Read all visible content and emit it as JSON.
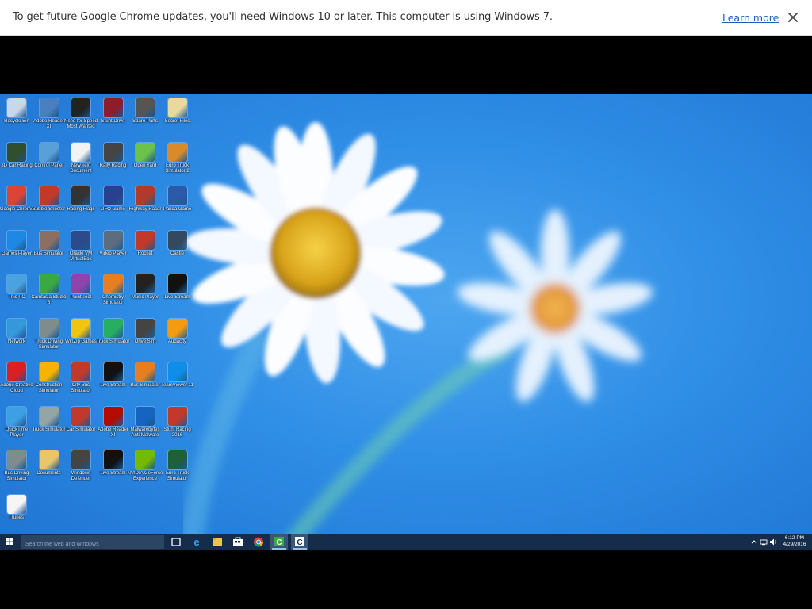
{
  "infobar": {
    "message": "To get future Google Chrome updates, you'll need Windows 10 or later. This computer is using Windows 7.",
    "learn_more": "Learn more"
  },
  "desktop": {
    "icons": [
      {
        "label": "Recycle Bin",
        "icon": "recycle-bin-icon",
        "color": "#c9d8e8"
      },
      {
        "label": "Adobe Reader XI",
        "icon": "app-icon",
        "color": "#4a7fc1"
      },
      {
        "label": "Need for Speed Most Wanted",
        "icon": "game-icon",
        "color": "#222222"
      },
      {
        "label": "Stunt Drive",
        "icon": "game-icon",
        "color": "#8b1d2c"
      },
      {
        "label": "Spare Parts",
        "icon": "game-icon",
        "color": "#555555"
      },
      {
        "label": "Secret Files",
        "icon": "folder-icon",
        "color": "#e8d9a0"
      },
      {
        "label": "3D Car Racing",
        "icon": "game-icon",
        "color": "#2f4f2f"
      },
      {
        "label": "Control Panel",
        "icon": "control-panel-icon",
        "color": "#5aa0d8"
      },
      {
        "label": "New Text Document",
        "icon": "document-icon",
        "color": "#f2f2f2"
      },
      {
        "label": "Rally Racing",
        "icon": "game-icon",
        "color": "#444444"
      },
      {
        "label": "Open Yard",
        "icon": "app-icon",
        "color": "#6cc24a"
      },
      {
        "label": "Euro Truck Simulator 2",
        "icon": "game-icon",
        "color": "#d98b2a"
      },
      {
        "label": "Google Chrome",
        "icon": "chrome-icon",
        "color": "#db4437"
      },
      {
        "label": "Bubble Shooter",
        "icon": "game-icon",
        "color": "#c0392b"
      },
      {
        "label": "Racing Flags",
        "icon": "game-icon",
        "color": "#333333"
      },
      {
        "label": "UFO Game",
        "icon": "game-icon",
        "color": "#2a3f8f"
      },
      {
        "label": "Highway Racer",
        "icon": "game-icon",
        "color": "#b03a2e"
      },
      {
        "label": "Panda Game",
        "icon": "game-icon",
        "color": "#2b5aa8"
      },
      {
        "label": "Games Player",
        "icon": "app-icon",
        "color": "#1e88e5"
      },
      {
        "label": "Bus Simulator",
        "icon": "game-icon",
        "color": "#8d6e63"
      },
      {
        "label": "Oracle VM VirtualBox",
        "icon": "virtualbox-icon",
        "color": "#2b4b8c"
      },
      {
        "label": "Video Player",
        "icon": "app-icon",
        "color": "#5d6d7e"
      },
      {
        "label": "Rocket",
        "icon": "game-icon",
        "color": "#c0392b"
      },
      {
        "label": "Castle",
        "icon": "game-icon",
        "color": "#34495e"
      },
      {
        "label": "This PC",
        "icon": "computer-icon",
        "color": "#4aa3df"
      },
      {
        "label": "Camtasia Studio 8",
        "icon": "camtasia-icon",
        "color": "#3aa845"
      },
      {
        "label": "Paint Tool",
        "icon": "app-icon",
        "color": "#8e44ad"
      },
      {
        "label": "Chemistry Simulator",
        "icon": "app-icon",
        "color": "#e67e22"
      },
      {
        "label": "Music Player",
        "icon": "music-icon",
        "color": "#222222"
      },
      {
        "label": "Live Stream",
        "icon": "app-icon",
        "color": "#111111"
      },
      {
        "label": "Network",
        "icon": "network-icon",
        "color": "#3498db"
      },
      {
        "label": "Truck Driving Simulator",
        "icon": "game-icon",
        "color": "#7f8c8d"
      },
      {
        "label": "WinZip Games",
        "icon": "game-icon",
        "color": "#f1c40f"
      },
      {
        "label": "Truck Simulator",
        "icon": "game-icon",
        "color": "#27ae60"
      },
      {
        "label": "Drive Sim",
        "icon": "game-icon",
        "color": "#444444"
      },
      {
        "label": "Audacity",
        "icon": "audacity-icon",
        "color": "#f39c12"
      },
      {
        "label": "Adobe Creative Cloud",
        "icon": "adobe-cc-icon",
        "color": "#da1f26"
      },
      {
        "label": "Construction Simulator",
        "icon": "game-icon",
        "color": "#f4b400"
      },
      {
        "label": "City Bus Simulator",
        "icon": "game-icon",
        "color": "#c0392b"
      },
      {
        "label": "Live Stream",
        "icon": "app-icon",
        "color": "#111111"
      },
      {
        "label": "Bus Simulator",
        "icon": "game-icon",
        "color": "#e67e22"
      },
      {
        "label": "TeamViewer 11",
        "icon": "teamviewer-icon",
        "color": "#0e8ee9"
      },
      {
        "label": "QuickTime Player",
        "icon": "quicktime-icon",
        "color": "#3ea0e4"
      },
      {
        "label": "Truck Simulator",
        "icon": "game-icon",
        "color": "#95a5a6"
      },
      {
        "label": "Car Simulator",
        "icon": "game-icon",
        "color": "#c0392b"
      },
      {
        "label": "Adobe Reader XI",
        "icon": "acrobat-icon",
        "color": "#b30b00"
      },
      {
        "label": "Malwarebytes Anti-Malware",
        "icon": "malwarebytes-icon",
        "color": "#1565c0"
      },
      {
        "label": "Stunt Racing 2016",
        "icon": "game-icon",
        "color": "#c0392b"
      },
      {
        "label": "Bus Driving Simulator",
        "icon": "game-icon",
        "color": "#7f8c8d"
      },
      {
        "label": "Documents",
        "icon": "folder-icon",
        "color": "#e8c66a"
      },
      {
        "label": "Windows Defender",
        "icon": "app-icon",
        "color": "#444444"
      },
      {
        "label": "Live Stream",
        "icon": "app-icon",
        "color": "#111111"
      },
      {
        "label": "NVIDIA GeForce Experience",
        "icon": "nvidia-icon",
        "color": "#76b900"
      },
      {
        "label": "Euro Truck Simulator",
        "icon": "game-icon",
        "color": "#1f5f3a"
      },
      {
        "label": "iTunes",
        "icon": "itunes-icon",
        "color": "#f5f5f5"
      }
    ]
  },
  "taskbar": {
    "search_placeholder": "Search the web and Windows",
    "apps": [
      {
        "name": "task-view-icon",
        "active": false
      },
      {
        "name": "edge-icon",
        "active": false
      },
      {
        "name": "file-explorer-icon",
        "active": false
      },
      {
        "name": "store-icon",
        "active": false
      },
      {
        "name": "chrome-icon",
        "active": false
      },
      {
        "name": "camtasia-icon",
        "active": true
      },
      {
        "name": "camtasia-recorder-icon",
        "active": true
      }
    ],
    "time": "6:12 PM",
    "date": "4/29/2016"
  }
}
